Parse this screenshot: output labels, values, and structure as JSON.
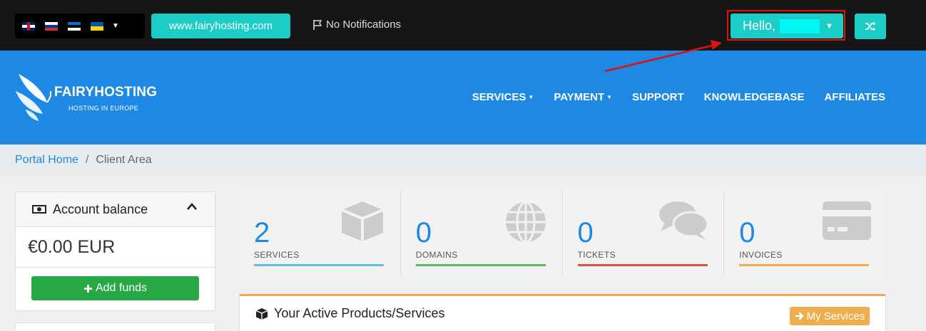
{
  "topbar": {
    "languages": [
      "flag-uk-icon",
      "flag-ru-icon",
      "flag-ee-icon",
      "flag-ua-icon"
    ],
    "site_link": "www.fairyhosting.com",
    "notifications": "No Notifications",
    "hello": "Hello,"
  },
  "header": {
    "logo_name": "FAIRYHOSTING",
    "logo_sub": "HOSTING IN EUROPE",
    "nav": [
      {
        "label": "SERVICES",
        "dropdown": true
      },
      {
        "label": "PAYMENT",
        "dropdown": true
      },
      {
        "label": "SUPPORT",
        "dropdown": false
      },
      {
        "label": "KNOWLEDGEBASE",
        "dropdown": false
      },
      {
        "label": "AFFILIATES",
        "dropdown": false
      }
    ]
  },
  "breadcrumb": {
    "home": "Portal Home",
    "separator": "/",
    "current": "Client Area"
  },
  "sidebar": {
    "title": "Account balance",
    "balance": "€0.00 EUR",
    "add_funds": "Add funds"
  },
  "stats": [
    {
      "count": "2",
      "label": "SERVICES",
      "color": "#5bc0de",
      "icon": "cube-icon"
    },
    {
      "count": "0",
      "label": "DOMAINS",
      "color": "#5cb85c",
      "icon": "globe-icon"
    },
    {
      "count": "0",
      "label": "TICKETS",
      "color": "#d9534f",
      "icon": "comments-icon"
    },
    {
      "count": "0",
      "label": "INVOICES",
      "color": "#f0ad4e",
      "icon": "credit-card-icon"
    }
  ],
  "products": {
    "title": "Your Active Products/Services",
    "my_services": "My Services"
  },
  "colors": {
    "teal": "#1ccdc7",
    "blue": "#1e88e5",
    "dark": "#151515",
    "highlight": "#e01010"
  }
}
